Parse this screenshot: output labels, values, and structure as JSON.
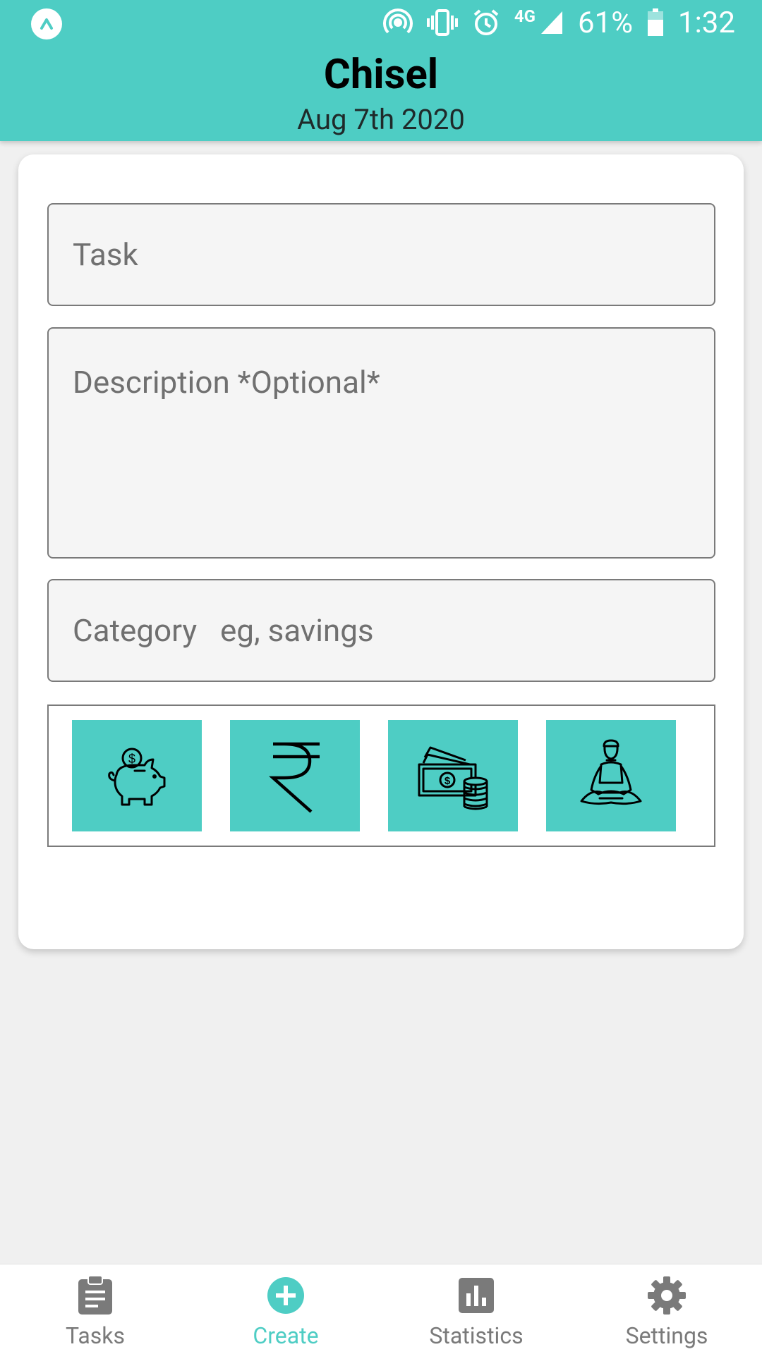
{
  "status_bar": {
    "battery": "61%",
    "time": "1:32",
    "network": "4G"
  },
  "header": {
    "title": "Chisel",
    "date": "Aug 7th 2020"
  },
  "form": {
    "task_placeholder": "Task",
    "description_placeholder": "Description *Optional*",
    "category_placeholder": "Category   eg, savings"
  },
  "category_icons": [
    {
      "name": "piggy-bank-icon"
    },
    {
      "name": "rupee-icon"
    },
    {
      "name": "cash-coins-icon"
    },
    {
      "name": "meditation-icon"
    }
  ],
  "bottom_nav": {
    "items": [
      {
        "label": "Tasks",
        "icon": "clipboard-icon"
      },
      {
        "label": "Create",
        "icon": "add-circle-icon"
      },
      {
        "label": "Statistics",
        "icon": "bar-chart-icon"
      },
      {
        "label": "Settings",
        "icon": "gear-icon"
      }
    ],
    "active": "Create"
  },
  "colors": {
    "accent": "#4ecdc4",
    "inactive": "#7a7a7a",
    "background": "#f0f0f0"
  }
}
